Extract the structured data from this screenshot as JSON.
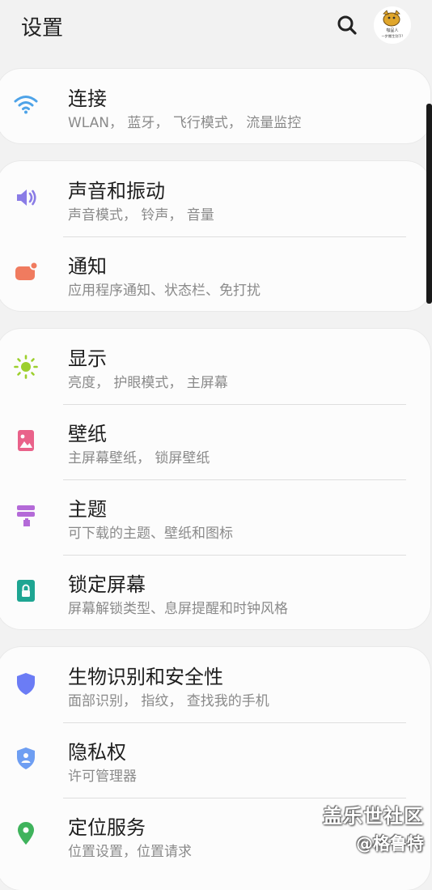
{
  "header": {
    "title": "设置",
    "search_icon": "search-icon",
    "avatar_text_1": "咖呈人",
    "avatar_text_2": "一步搬生别下!"
  },
  "colors": {
    "wifi": "#4ea3e8",
    "sound": "#8a7ce6",
    "notify": "#f07b5f",
    "display": "#9ccf2c",
    "wallpaper": "#e9628a",
    "theme": "#b46ad8",
    "lock": "#1ea592",
    "biometric": "#6b7cf5",
    "privacy": "#6e9ef2",
    "location": "#3fb35c"
  },
  "sections": [
    {
      "items": [
        {
          "icon": "wifi-icon",
          "title": "连接",
          "subtitle": "WLAN， 蓝牙， 飞行模式， 流量监控"
        }
      ]
    },
    {
      "items": [
        {
          "icon": "volume-icon",
          "title": "声音和振动",
          "subtitle": "声音模式， 铃声， 音量"
        },
        {
          "icon": "notification-icon",
          "title": "通知",
          "subtitle": "应用程序通知、状态栏、免打扰"
        }
      ]
    },
    {
      "items": [
        {
          "icon": "brightness-icon",
          "title": "显示",
          "subtitle": "亮度， 护眼模式， 主屏幕"
        },
        {
          "icon": "wallpaper-icon",
          "title": "壁纸",
          "subtitle": "主屏幕壁纸， 锁屏壁纸"
        },
        {
          "icon": "theme-brush-icon",
          "title": "主题",
          "subtitle": "可下载的主题、壁纸和图标"
        },
        {
          "icon": "lock-icon",
          "title": "锁定屏幕",
          "subtitle": "屏幕解锁类型、息屏提醒和时钟风格"
        }
      ]
    },
    {
      "items": [
        {
          "icon": "shield-icon",
          "title": "生物识别和安全性",
          "subtitle": "面部识别， 指纹， 查找我的手机"
        },
        {
          "icon": "privacy-shield-icon",
          "title": "隐私权",
          "subtitle": "许可管理器"
        },
        {
          "icon": "location-pin-icon",
          "title": "定位服务",
          "subtitle": "位置设置，位置请求"
        }
      ]
    }
  ],
  "watermark": {
    "line1": "盖乐世社区",
    "line2": "@格鲁特"
  }
}
